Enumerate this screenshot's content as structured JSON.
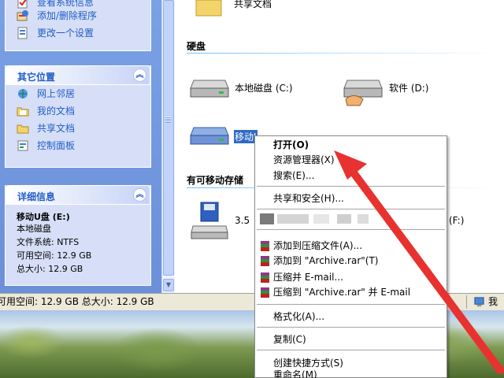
{
  "left_pane": {
    "system_tasks": {
      "items": [
        {
          "label": "查看系统信息",
          "icon": "system-info-icon"
        },
        {
          "label": "添加/删除程序",
          "icon": "add-remove-programs-icon"
        },
        {
          "label": "更改一个设置",
          "icon": "change-setting-icon"
        }
      ]
    },
    "other_places": {
      "title": "其它位置",
      "items": [
        {
          "label": "网上邻居",
          "icon": "network-places-icon"
        },
        {
          "label": "我的文档",
          "icon": "my-documents-icon"
        },
        {
          "label": "共享文档",
          "icon": "shared-documents-icon"
        },
        {
          "label": "控制面板",
          "icon": "control-panel-icon"
        }
      ]
    },
    "details": {
      "title": "详细信息",
      "name": "移动U盘 (E:)",
      "type": "本地磁盘",
      "filesystem": "文件系统: NTFS",
      "free": "可用空间: 12.9 GB",
      "total": "总大小: 12.9 GB"
    }
  },
  "main": {
    "shared_docs_label": "共享文档",
    "hard_disks_title": "硬盘",
    "drive_c": "本地磁盘 (C:)",
    "drive_d": "软件 (D:)",
    "drive_e": "移动U盘 (E:)",
    "removable_title": "有可移动存储",
    "floppy_label": "3.5",
    "drive_f": "(F:)"
  },
  "status_bar": {
    "left_text": "可用空间: 12.9 GB 总大小: 12.9 GB",
    "right_text": "我的"
  },
  "context_menu": {
    "items": {
      "open": "打开(O)",
      "explorer": "资源管理器(X)",
      "search": "搜索(E)...",
      "sharing": "共享和安全(H)...",
      "add_archive": "添加到压缩文件(A)...",
      "add_to_rar": "添加到 \"Archive.rar\"(T)",
      "compress_email": "压缩并 E-mail...",
      "compress_rar_email": "压缩到 \"Archive.rar\" 并 E-mail",
      "format": "格式化(A)...",
      "copy": "复制(C)",
      "shortcut": "创建快捷方式(S)",
      "rename": "重命名(M)"
    }
  },
  "colors": {
    "panel_title": "#215dc6",
    "arrow": "#e8322f"
  }
}
